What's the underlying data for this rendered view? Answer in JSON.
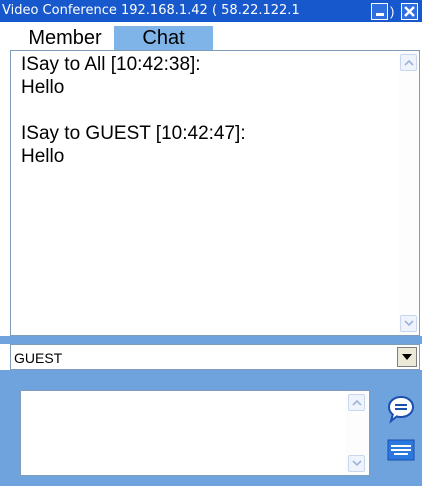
{
  "window": {
    "title": "Video Conference 192.168.1.42 ( 58.22.122.1",
    "separator": ")"
  },
  "tabs": [
    {
      "label": "Member",
      "active": false
    },
    {
      "label": "Chat",
      "active": true
    }
  ],
  "chat_log": {
    "text": "ISay to All [10:42:38]:\nHello\n\nISay to GUEST [10:42:47]:\nHello"
  },
  "recipient": {
    "selected": "GUEST"
  },
  "composer": {
    "value": "",
    "placeholder": ""
  },
  "icons": {
    "send": "speech-bubble-icon",
    "keyboard": "keyboard-icon"
  },
  "colors": {
    "titlebar": "#1758cc",
    "active_tab": "#7fb4e8",
    "panel": "#6fa3dd"
  }
}
